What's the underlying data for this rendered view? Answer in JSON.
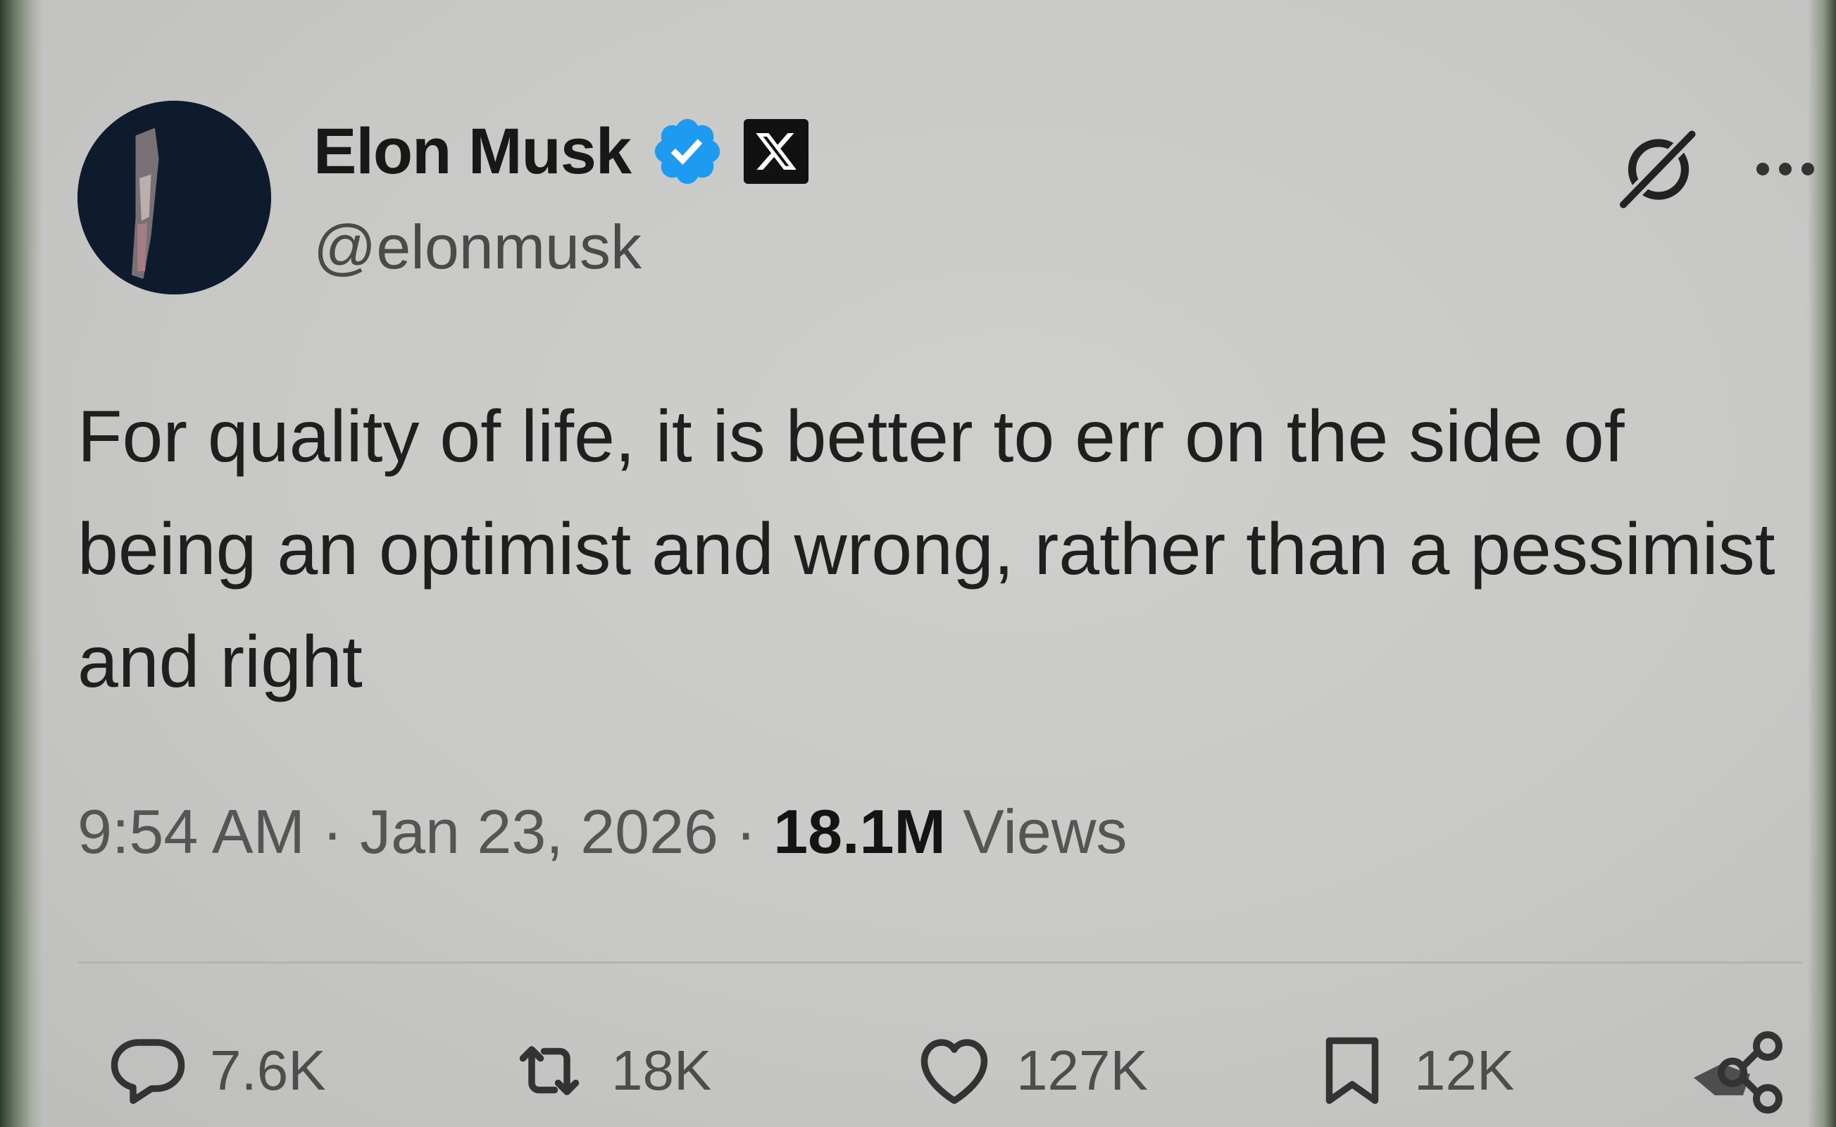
{
  "author": {
    "display_name": "Elon Musk",
    "handle": "@elonmusk",
    "verified_color": "#1d9bf0"
  },
  "icons": {
    "verified": "verified-badge-icon",
    "affiliate": "x-logo-icon",
    "grok": "grok-icon",
    "more": "more-options-icon",
    "reply": "reply-bubble-icon",
    "repost": "repost-arrows-icon",
    "like": "heart-icon",
    "bookmark": "bookmark-icon",
    "share": "share-icon"
  },
  "tweet": {
    "text": "For quality of life, it is better to err on the side of being an optimist and wrong, rather than a pessimist and right"
  },
  "meta": {
    "time": "9:54 AM",
    "separator": "·",
    "date": "Jan 23, 2026",
    "views_count": "18.1M",
    "views_label": "Views"
  },
  "actions": {
    "replies": "7.6K",
    "reposts": "18K",
    "likes": "127K",
    "bookmarks": "12K"
  }
}
